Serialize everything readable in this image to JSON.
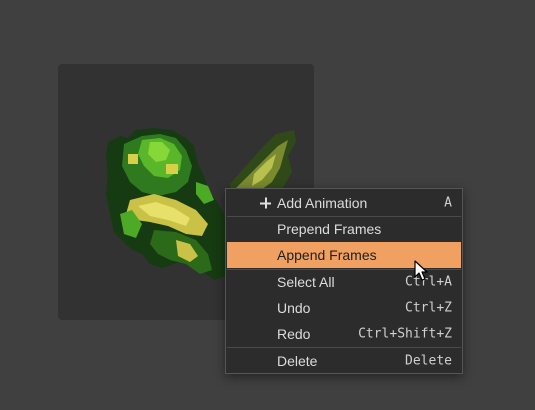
{
  "canvas": {
    "background": "#323232"
  },
  "context_menu": {
    "accent_color": "#f0a060",
    "items": [
      {
        "label": "Add Animation",
        "shortcut": "A",
        "icon": "plus-icon"
      },
      {
        "label": "Prepend Frames",
        "shortcut": ""
      },
      {
        "label": "Append Frames",
        "shortcut": "",
        "highlighted": true
      },
      {
        "label": "Select All",
        "shortcut": "Ctrl+A"
      },
      {
        "label": "Undo",
        "shortcut": "Ctrl+Z"
      },
      {
        "label": "Redo",
        "shortcut": "Ctrl+Shift+Z"
      },
      {
        "label": "Delete",
        "shortcut": "Delete"
      }
    ]
  },
  "cursor": {
    "icon": "arrow-cursor-icon"
  }
}
